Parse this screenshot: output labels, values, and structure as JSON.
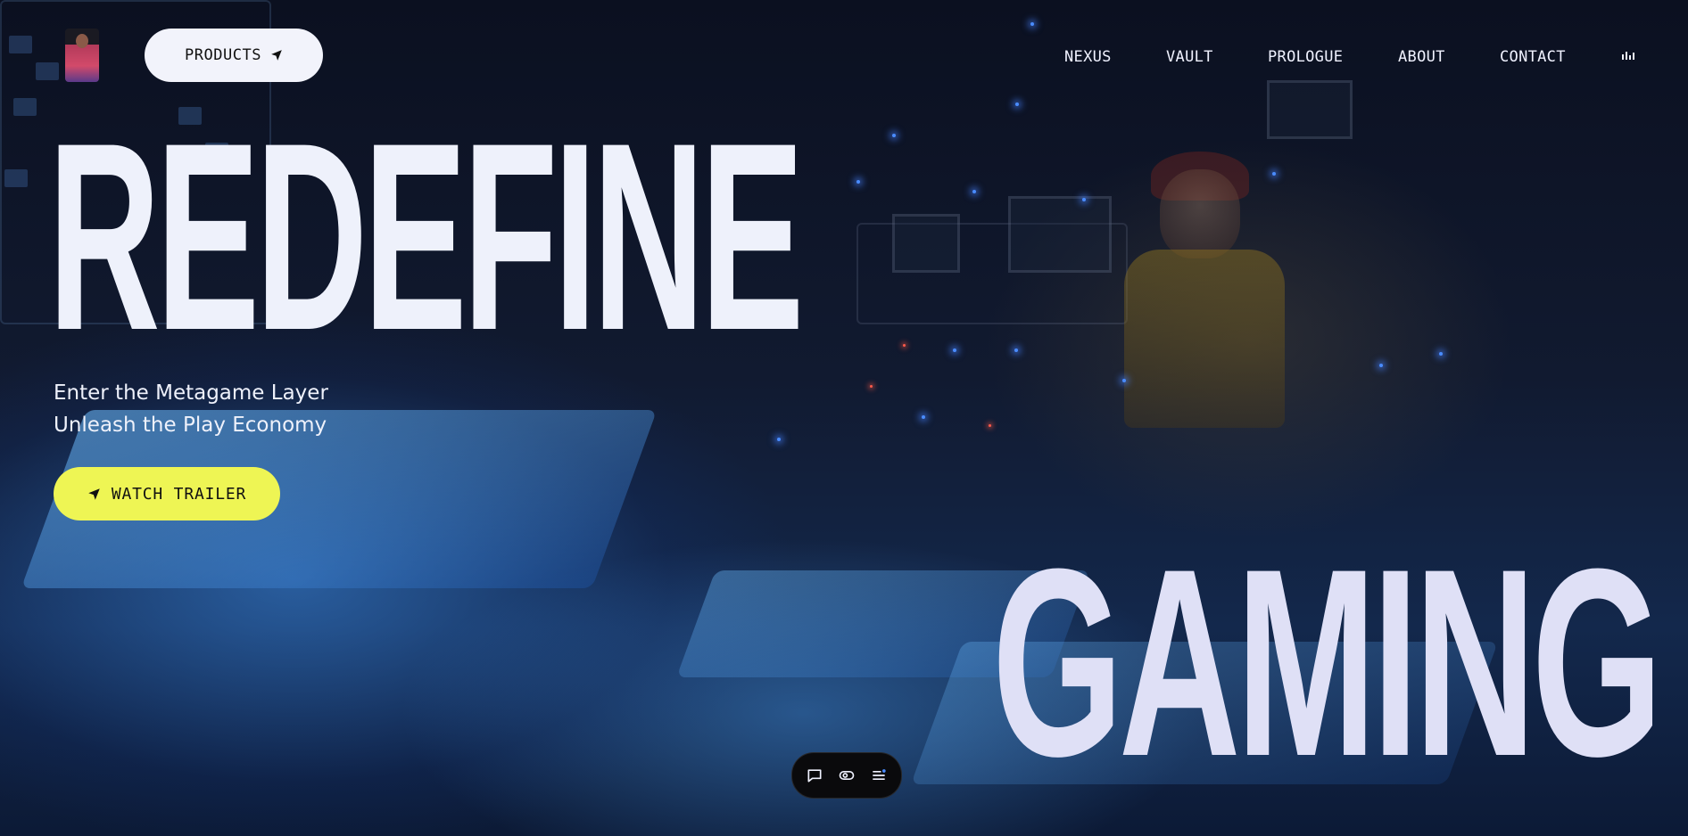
{
  "header": {
    "products_label": "PRODUCTS",
    "nav": [
      "NEXUS",
      "VAULT",
      "PROLOGUE",
      "ABOUT",
      "CONTACT"
    ]
  },
  "hero": {
    "title": "REDEFINE",
    "subtitle_line1": "Enter the Metagame Layer",
    "subtitle_line2": "Unleash the Play Economy",
    "cta_label": "WATCH TRAILER",
    "big_word": "GAMING"
  },
  "icons": {
    "products_button": "send-arrow-icon",
    "cta_button": "send-arrow-icon",
    "audio": "audio-bars-icon",
    "dock": [
      "chat-bubble-icon",
      "toggle-icon",
      "menu-icon"
    ]
  },
  "colors": {
    "accent_yellow": "#eef554",
    "title_white": "#eef1fb",
    "pill_white": "#f2f3fb",
    "dock_dark": "#0a0a0c"
  }
}
